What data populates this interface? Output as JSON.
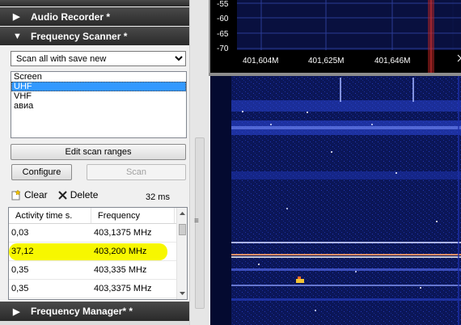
{
  "panels": {
    "audio_recorder": {
      "title": "Audio Recorder *",
      "arrow": "▶"
    },
    "frequency_scanner": {
      "title": "Frequency Scanner *",
      "arrow": "▼"
    },
    "frequency_manager": {
      "title": "Frequency Manager* *",
      "arrow": "▶"
    }
  },
  "scanner": {
    "mode": "Scan all with save new",
    "list_items": [
      {
        "label": "Screen",
        "selected": false
      },
      {
        "label": "UHF",
        "selected": true
      },
      {
        "label": "VHF",
        "selected": false
      },
      {
        "label": "авиа",
        "selected": false
      }
    ],
    "edit_ranges_label": "Edit scan ranges",
    "configure_label": "Configure",
    "scan_label": "Scan",
    "clear_label": "Clear",
    "delete_label": "Delete",
    "speed": "32 ms"
  },
  "results_table": {
    "headers": [
      "Activity time s.",
      "Frequency"
    ],
    "rows": [
      {
        "activity": "0,03",
        "frequency": "403,1375 MHz"
      },
      {
        "activity": "37,12",
        "frequency": "403,200 MHz",
        "highlighted": true
      },
      {
        "activity": "0,35",
        "frequency": "403,335 MHz"
      },
      {
        "activity": "0,35",
        "frequency": "403,3375 MHz"
      }
    ]
  },
  "spectrum": {
    "y_ticks": [
      "-55",
      "-60",
      "-65",
      "-70"
    ],
    "x_ticks": [
      "401,604M",
      "401,625M",
      "401,646M"
    ],
    "colors": {
      "background": "#000000",
      "grid": "#2a3a8a",
      "marker": "#b22222",
      "waterfall_bg": "#08104a"
    }
  },
  "colors": {
    "header_dark": "#333333",
    "selection": "#3399ff",
    "highlight": "#f7f700"
  }
}
